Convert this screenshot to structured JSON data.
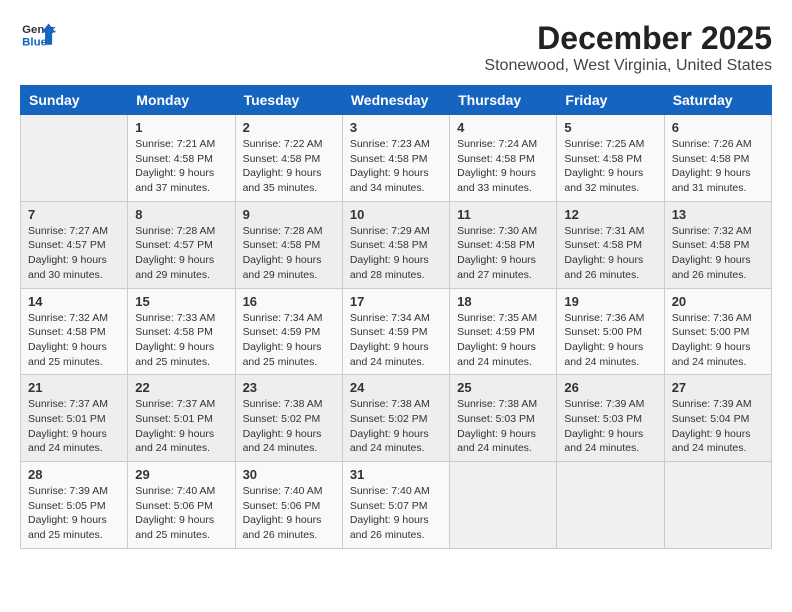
{
  "logo": {
    "line1": "General",
    "line2": "Blue"
  },
  "title": "December 2025",
  "subtitle": "Stonewood, West Virginia, United States",
  "days_header": [
    "Sunday",
    "Monday",
    "Tuesday",
    "Wednesday",
    "Thursday",
    "Friday",
    "Saturday"
  ],
  "weeks": [
    [
      {
        "day": "",
        "info": ""
      },
      {
        "day": "1",
        "info": "Sunrise: 7:21 AM\nSunset: 4:58 PM\nDaylight: 9 hours\nand 37 minutes."
      },
      {
        "day": "2",
        "info": "Sunrise: 7:22 AM\nSunset: 4:58 PM\nDaylight: 9 hours\nand 35 minutes."
      },
      {
        "day": "3",
        "info": "Sunrise: 7:23 AM\nSunset: 4:58 PM\nDaylight: 9 hours\nand 34 minutes."
      },
      {
        "day": "4",
        "info": "Sunrise: 7:24 AM\nSunset: 4:58 PM\nDaylight: 9 hours\nand 33 minutes."
      },
      {
        "day": "5",
        "info": "Sunrise: 7:25 AM\nSunset: 4:58 PM\nDaylight: 9 hours\nand 32 minutes."
      },
      {
        "day": "6",
        "info": "Sunrise: 7:26 AM\nSunset: 4:58 PM\nDaylight: 9 hours\nand 31 minutes."
      }
    ],
    [
      {
        "day": "7",
        "info": "Sunrise: 7:27 AM\nSunset: 4:57 PM\nDaylight: 9 hours\nand 30 minutes."
      },
      {
        "day": "8",
        "info": "Sunrise: 7:28 AM\nSunset: 4:57 PM\nDaylight: 9 hours\nand 29 minutes."
      },
      {
        "day": "9",
        "info": "Sunrise: 7:28 AM\nSunset: 4:58 PM\nDaylight: 9 hours\nand 29 minutes."
      },
      {
        "day": "10",
        "info": "Sunrise: 7:29 AM\nSunset: 4:58 PM\nDaylight: 9 hours\nand 28 minutes."
      },
      {
        "day": "11",
        "info": "Sunrise: 7:30 AM\nSunset: 4:58 PM\nDaylight: 9 hours\nand 27 minutes."
      },
      {
        "day": "12",
        "info": "Sunrise: 7:31 AM\nSunset: 4:58 PM\nDaylight: 9 hours\nand 26 minutes."
      },
      {
        "day": "13",
        "info": "Sunrise: 7:32 AM\nSunset: 4:58 PM\nDaylight: 9 hours\nand 26 minutes."
      }
    ],
    [
      {
        "day": "14",
        "info": "Sunrise: 7:32 AM\nSunset: 4:58 PM\nDaylight: 9 hours\nand 25 minutes."
      },
      {
        "day": "15",
        "info": "Sunrise: 7:33 AM\nSunset: 4:58 PM\nDaylight: 9 hours\nand 25 minutes."
      },
      {
        "day": "16",
        "info": "Sunrise: 7:34 AM\nSunset: 4:59 PM\nDaylight: 9 hours\nand 25 minutes."
      },
      {
        "day": "17",
        "info": "Sunrise: 7:34 AM\nSunset: 4:59 PM\nDaylight: 9 hours\nand 24 minutes."
      },
      {
        "day": "18",
        "info": "Sunrise: 7:35 AM\nSunset: 4:59 PM\nDaylight: 9 hours\nand 24 minutes."
      },
      {
        "day": "19",
        "info": "Sunrise: 7:36 AM\nSunset: 5:00 PM\nDaylight: 9 hours\nand 24 minutes."
      },
      {
        "day": "20",
        "info": "Sunrise: 7:36 AM\nSunset: 5:00 PM\nDaylight: 9 hours\nand 24 minutes."
      }
    ],
    [
      {
        "day": "21",
        "info": "Sunrise: 7:37 AM\nSunset: 5:01 PM\nDaylight: 9 hours\nand 24 minutes."
      },
      {
        "day": "22",
        "info": "Sunrise: 7:37 AM\nSunset: 5:01 PM\nDaylight: 9 hours\nand 24 minutes."
      },
      {
        "day": "23",
        "info": "Sunrise: 7:38 AM\nSunset: 5:02 PM\nDaylight: 9 hours\nand 24 minutes."
      },
      {
        "day": "24",
        "info": "Sunrise: 7:38 AM\nSunset: 5:02 PM\nDaylight: 9 hours\nand 24 minutes."
      },
      {
        "day": "25",
        "info": "Sunrise: 7:38 AM\nSunset: 5:03 PM\nDaylight: 9 hours\nand 24 minutes."
      },
      {
        "day": "26",
        "info": "Sunrise: 7:39 AM\nSunset: 5:03 PM\nDaylight: 9 hours\nand 24 minutes."
      },
      {
        "day": "27",
        "info": "Sunrise: 7:39 AM\nSunset: 5:04 PM\nDaylight: 9 hours\nand 24 minutes."
      }
    ],
    [
      {
        "day": "28",
        "info": "Sunrise: 7:39 AM\nSunset: 5:05 PM\nDaylight: 9 hours\nand 25 minutes."
      },
      {
        "day": "29",
        "info": "Sunrise: 7:40 AM\nSunset: 5:06 PM\nDaylight: 9 hours\nand 25 minutes."
      },
      {
        "day": "30",
        "info": "Sunrise: 7:40 AM\nSunset: 5:06 PM\nDaylight: 9 hours\nand 26 minutes."
      },
      {
        "day": "31",
        "info": "Sunrise: 7:40 AM\nSunset: 5:07 PM\nDaylight: 9 hours\nand 26 minutes."
      },
      {
        "day": "",
        "info": ""
      },
      {
        "day": "",
        "info": ""
      },
      {
        "day": "",
        "info": ""
      }
    ]
  ]
}
